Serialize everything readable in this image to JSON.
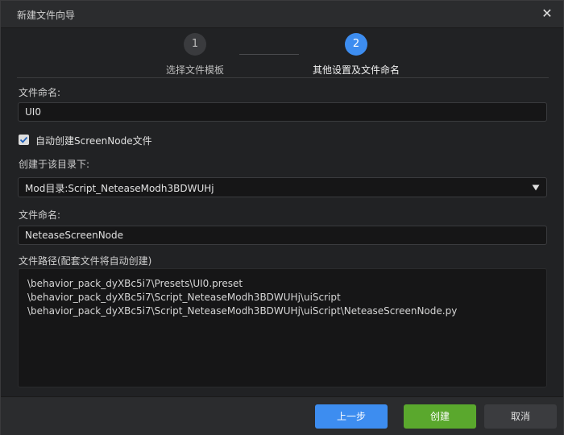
{
  "window": {
    "title": "新建文件向导",
    "close_icon": "close-icon"
  },
  "steps": [
    {
      "number": "1",
      "label": "选择文件模板",
      "active": false
    },
    {
      "number": "2",
      "label": "其他设置及文件命名",
      "active": true
    }
  ],
  "form": {
    "filename1_label": "文件命名:",
    "filename1_value": "UI0",
    "auto_create_checked": true,
    "auto_create_label": "自动创建ScreenNode文件",
    "directory_label": "创建于该目录下:",
    "directory_value": "Mod目录:Script_NeteaseModh3BDWUHj",
    "filename2_label": "文件命名:",
    "filename2_value": "NeteaseScreenNode",
    "paths_label": "文件路径(配套文件将自动创建)",
    "paths": [
      "\\behavior_pack_dyXBc5i7\\Presets\\UI0.preset",
      "\\behavior_pack_dyXBc5i7\\Script_NeteaseModh3BDWUHj\\uiScript",
      "\\behavior_pack_dyXBc5i7\\Script_NeteaseModh3BDWUHj\\uiScript\\NeteaseScreenNode.py"
    ]
  },
  "footer": {
    "prev_label": "上一步",
    "create_label": "创建",
    "cancel_label": "取消"
  },
  "colors": {
    "accent": "#3d8df0",
    "create": "#5aa82d",
    "background": "#212224"
  }
}
